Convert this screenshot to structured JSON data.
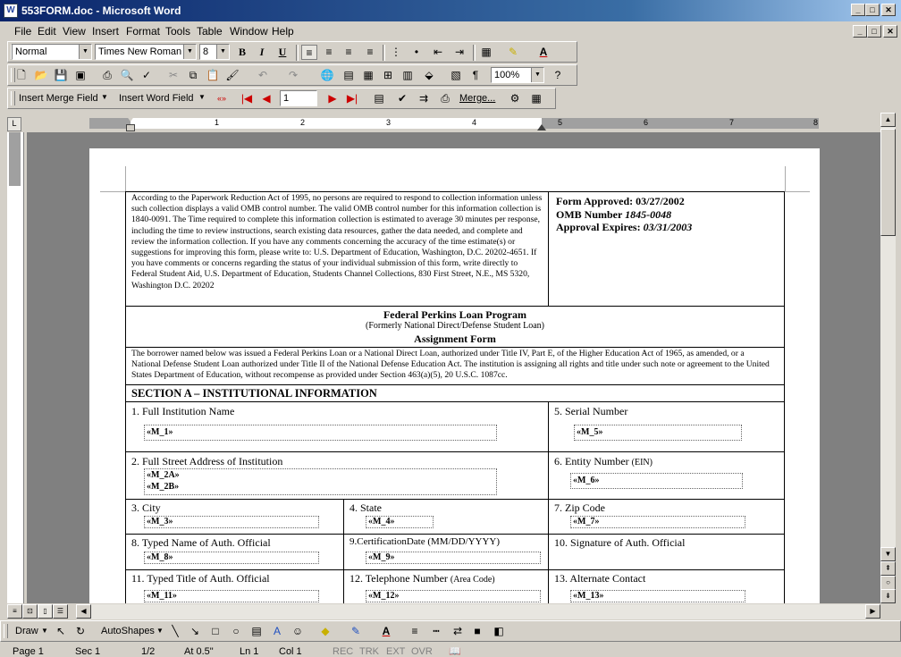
{
  "window": {
    "title": "553FORM.doc - Microsoft Word",
    "app_icon": "W"
  },
  "menu": [
    "File",
    "Edit",
    "View",
    "Insert",
    "Format",
    "Tools",
    "Table",
    "Window",
    "Help"
  ],
  "formatting": {
    "style": "Normal",
    "font": "Times New Roman",
    "size": "8",
    "zoom": "100%"
  },
  "mailmerge": {
    "insert_merge_field": "Insert Merge Field",
    "insert_word_field": "Insert Word Field",
    "record": "1",
    "merge": "Merge..."
  },
  "ruler_numbers": [
    "1",
    "2",
    "3",
    "4",
    "5",
    "6",
    "7",
    "8"
  ],
  "form": {
    "paperwork": "According to the Paperwork Reduction Act of 1995, no persons are required to respond to collection information unless such collection displays a valid OMB control number.  The valid OMB control number for this information collection is 1840-0091.  The Time required to complete this information collection is estimated to average 30 minutes per response, including the time to review instructions, search existing data resources, gather the data needed, and complete and review the information collection.  If you have any comments concerning the accuracy of the time estimate(s) or suggestions for improving this form, please write to:  U.S. Department of Education, Washington, D.C. 20202-4651.  If you have comments or concerns regarding the status of your individual submission of this form, write directly to Federal Student Aid, U.S. Department of Education, Students Channel Collections, 830 First Street, N.E., MS 5320, Washington D.C. 20202",
    "approved": "Form Approved: 03/27/2002",
    "omb_label": "OMB Number ",
    "omb_value": "1845-0048",
    "expires_label": "Approval Expires:  ",
    "expires_value": "03/31/2003",
    "program": "Federal Perkins Loan Program",
    "formerly": "(Formerly National Direct/Defense Student Loan)",
    "form_title": "Assignment Form",
    "intro": "The borrower named below was issued a Federal Perkins Loan or a National Direct Loan, authorized under Title IV, Part E, of the Higher Education Act of 1965, as amended, or a National Defense Student Loan authorized under Title II of the National Defense Education Act.  The institution is assigning all rights and title under such note or agreement to the United States Department of Education, without recompense as provided under Section 463(a)(5), 20 U.S.C. 1087cc.",
    "section_a": "SECTION A – INSTITUTIONAL INFORMATION",
    "labels": {
      "l1": "1.  Full Institution Name",
      "l5": "5.  Serial Number",
      "l2": "2.  Full Street Address of Institution",
      "l6": "6.  Entity Number ",
      "l6b": "(EIN)",
      "l3": "3.  City",
      "l4": "4.  State",
      "l7": "7.  Zip Code",
      "l8": "8.  Typed Name of Auth. Official",
      "l9": "9.CertificationDate (MM/DD/YYYY)",
      "l10": "10.  Signature of Auth. Official",
      "l11": "11.  Typed Title of Auth. Official",
      "l12": "12.  Telephone Number ",
      "l12b": "(Area Code)",
      "l13": "13.  Alternate Contact"
    },
    "fields": {
      "m1": "«M_1»",
      "m5": "«M_5»",
      "m2a": "«M_2A»",
      "m2b": "«M_2B»",
      "m6": "«M_6»",
      "m3": "«M_3»",
      "m4": "«M_4»",
      "m7": "«M_7»",
      "m8": "«M_8»",
      "m9": "«M_9»",
      "m11": "«M_11»",
      "m12": "«M_12»",
      "m13": "«M_13»"
    }
  },
  "drawing": {
    "draw": "Draw",
    "autoshapes": "AutoShapes"
  },
  "status": {
    "page": "Page  1",
    "sec": "Sec  1",
    "pos": "1/2",
    "at": "At  0.5\"",
    "ln": "Ln  1",
    "col": "Col  1",
    "rec": "REC",
    "trk": "TRK",
    "ext": "EXT",
    "ovr": "OVR"
  }
}
